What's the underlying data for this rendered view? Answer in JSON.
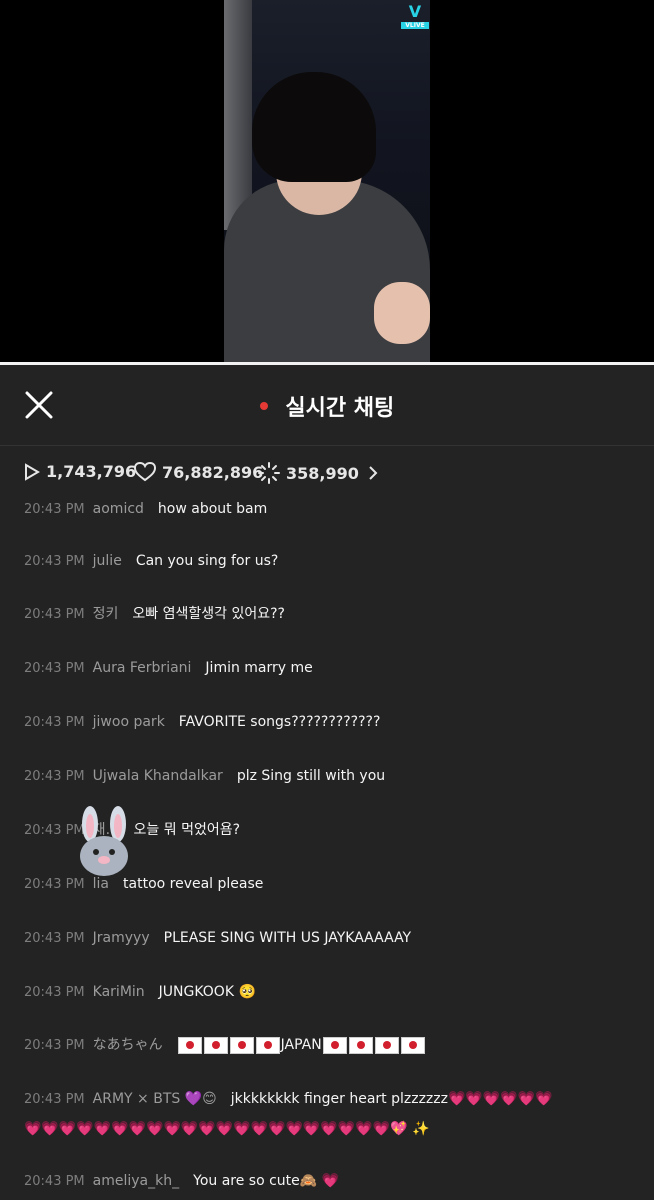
{
  "video": {
    "badge_logo": "V",
    "badge_text": "VLIVE"
  },
  "header": {
    "title": "실시간 채팅",
    "close_icon": "close-icon"
  },
  "stats": {
    "plays": "1,743,796",
    "likes": "76,882,896",
    "sparkle": "358,990"
  },
  "chat": [
    {
      "time": "20:43 PM",
      "user": "aomicd",
      "text": "how about bam"
    },
    {
      "time": "20:43 PM",
      "user": "julie",
      "text": "Can you sing for us?"
    },
    {
      "time": "20:43 PM",
      "user": "정키",
      "text": "오빠 염색할생각 있어요??"
    },
    {
      "time": "20:43 PM",
      "user": "Aura Ferbriani",
      "text": "Jimin marry me"
    },
    {
      "time": "20:43 PM",
      "user": "jiwoo park",
      "text": "FAVORITE songs????????????"
    },
    {
      "time": "20:43 PM",
      "user": "Ujwala Khandalkar",
      "text": "plz Sing still with you"
    },
    {
      "time": "20:43 PM",
      "user": "재…",
      "text": "오늘 뭐 먹었어욤?"
    },
    {
      "time": "20:43 PM",
      "user": "lia",
      "text": "tattoo reveal please"
    },
    {
      "time": "20:43 PM",
      "user": "Jramyyy",
      "text": "PLEASE SING WITH US JAYKAAAAAY"
    },
    {
      "time": "20:43 PM",
      "user": "KariMin",
      "text": "JUNGKOOK 🥺"
    },
    {
      "time": "20:43 PM",
      "user": "なあちゃん",
      "text": "JAPAN"
    },
    {
      "time": "20:43 PM",
      "user": "ARMY × BTS 💜😊",
      "text": "jkkkkkkkk finger heart plzzzzzz",
      "hearts_line1": "💗💗💗💗💗💗",
      "hearts_line2": "💗💗💗💗💗💗💗💗💗💗💗💗💗💗💗💗💗💗💗💗💗💖 ✨"
    },
    {
      "time": "20:43 PM",
      "user": "ameliya_kh_",
      "text": "You are so cute🙈 💗"
    }
  ]
}
